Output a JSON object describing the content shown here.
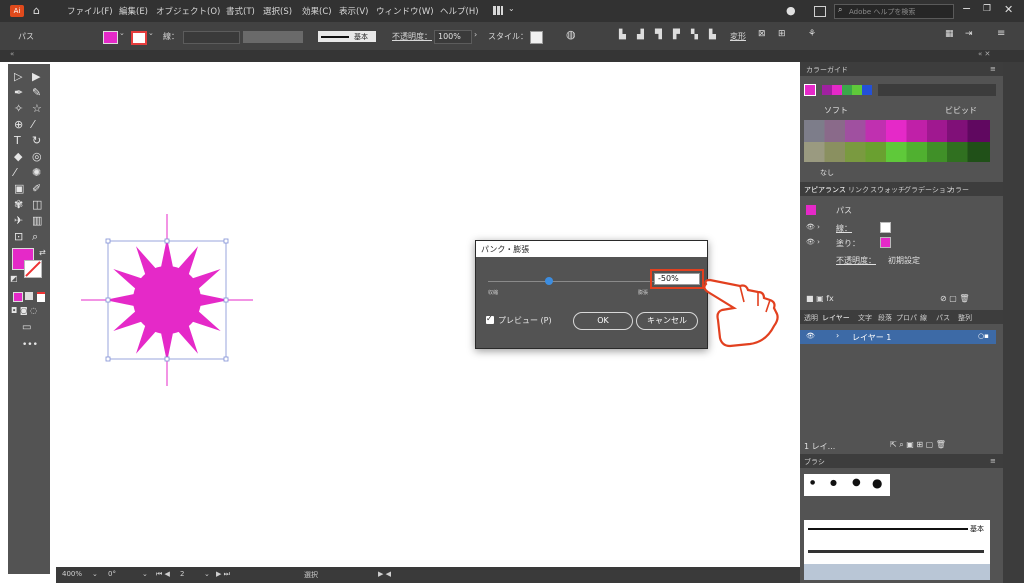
{
  "menubar": {
    "app_icon": "Ai",
    "items": [
      "ファイル(F)",
      "編集(E)",
      "オブジェクト(O)",
      "書式(T)",
      "選択(S)",
      "効果(C)",
      "表示(V)",
      "ウィンドウ(W)",
      "ヘルプ(H)"
    ],
    "search_placeholder": "Adobe ヘルプを検索"
  },
  "controlbar": {
    "selection_label": "パス",
    "stroke_label": "線：",
    "stroke_style": "基本",
    "opacity_label": "不透明度：",
    "opacity_value": "100%",
    "style_label": "スタイル：",
    "transform_label": "変形"
  },
  "canvas": {
    "shape_color": "#e529c8"
  },
  "statusbar": {
    "zoom": "400%",
    "rotation": "0°",
    "artboard": "2",
    "tool": "選択"
  },
  "dialog": {
    "title": "パンク・膨張",
    "value": "-50%",
    "slider_left": "収縮",
    "slider_right": "膨張",
    "preview_label": "プレビュー (P)",
    "ok_label": "OK",
    "cancel_label": "キャンセル"
  },
  "color_guide": {
    "title": "カラーガイド",
    "soft_label": "ソフト",
    "vivid_label": "ビビッド",
    "none_label": "なし"
  },
  "appearance": {
    "tabs": [
      "アピアランス",
      "リンク",
      "スウォッチ",
      "グラデーション",
      "カラー"
    ],
    "object_label": "パス",
    "stroke_label": "線：",
    "fill_label": "塗り：",
    "opacity_label": "不透明度：",
    "opacity_value": "初期設定"
  },
  "layers": {
    "tabs": [
      "透明",
      "レイヤー",
      "文字",
      "段落",
      "プロパ",
      "線",
      "パス",
      "整列"
    ],
    "layer_name": "レイヤー 1",
    "footer_count": "1 レイ..."
  },
  "brushes": {
    "title": "ブラシ",
    "basic_label": "基本"
  },
  "colors": {
    "magenta": "#e529c8",
    "ui_dark": "#323232",
    "panel": "#535353",
    "highlight": "#e2401f",
    "layer_blue": "#3d6aa6"
  }
}
